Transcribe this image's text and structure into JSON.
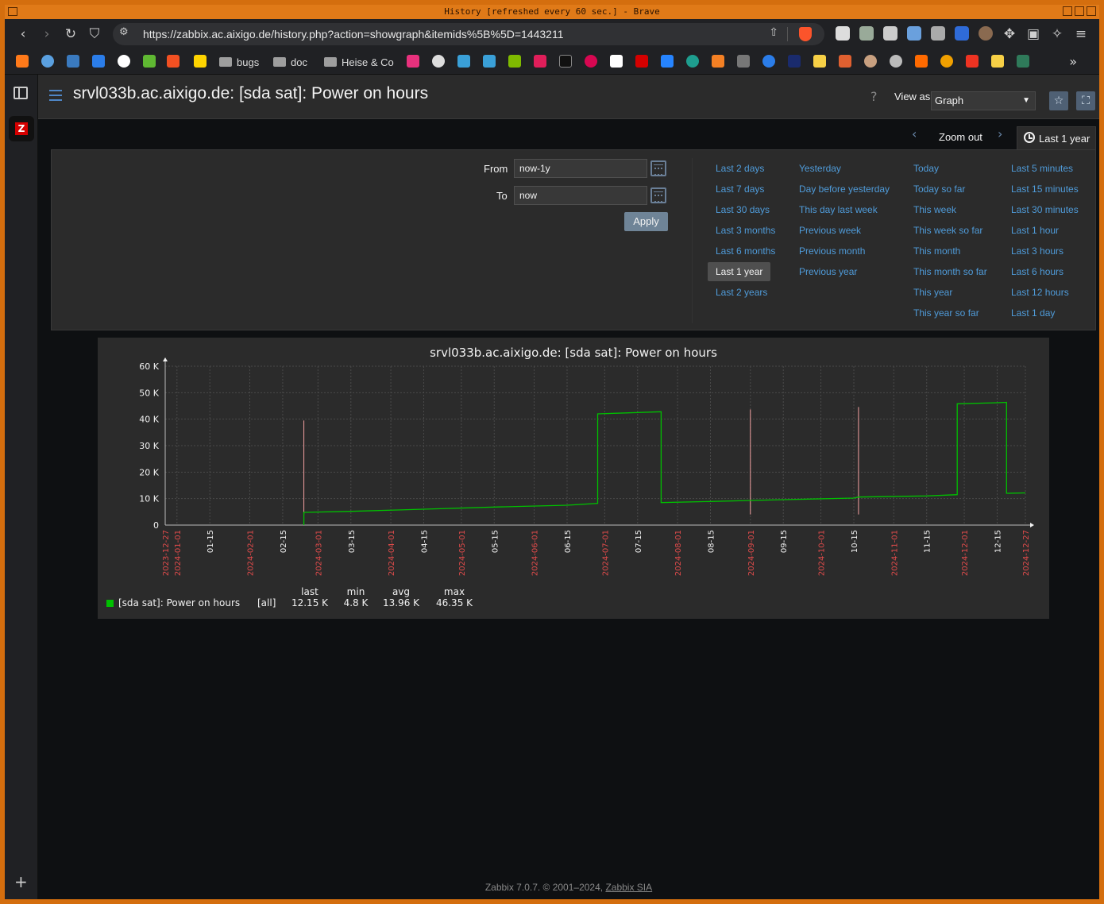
{
  "window": {
    "title": "History [refreshed every 60 sec.] - Brave"
  },
  "browser": {
    "url": "https://zabbix.ac.aixigo.de/history.php?action=showgraph&itemids%5B%5D=1443211",
    "bookmarks": [
      {
        "label": "bugs"
      },
      {
        "label": "doc"
      },
      {
        "label": "Heise & Co"
      }
    ],
    "more_symbol": "»"
  },
  "header": {
    "title": "srvl033b.ac.aixigo.de: [sda sat]: Power on hours",
    "help_symbol": "?",
    "view_as_label": "View as",
    "view_as_value": "Graph"
  },
  "timebar": {
    "zoom_out_label": "Zoom out",
    "active_tab_label": "Last 1 year"
  },
  "filter": {
    "from_label": "From",
    "from_value": "now-1y",
    "to_label": "To",
    "to_value": "now",
    "apply_label": "Apply",
    "quick_ranges": [
      [
        "Last 2 days",
        "Last 7 days",
        "Last 30 days",
        "Last 3 months",
        "Last 6 months",
        "Last 1 year",
        "Last 2 years"
      ],
      [
        "Yesterday",
        "Day before yesterday",
        "This day last week",
        "Previous week",
        "Previous month",
        "Previous year"
      ],
      [
        "Today",
        "Today so far",
        "This week",
        "This week so far",
        "This month",
        "This month so far",
        "This year",
        "This year so far"
      ],
      [
        "Last 5 minutes",
        "Last 15 minutes",
        "Last 30 minutes",
        "Last 1 hour",
        "Last 3 hours",
        "Last 6 hours",
        "Last 12 hours",
        "Last 1 day"
      ]
    ],
    "selected_range": "Last 1 year"
  },
  "chart_data": {
    "type": "line",
    "title": "srvl033b.ac.aixigo.de: [sda sat]: Power on hours",
    "y_ticks": [
      "0",
      "10 K",
      "20 K",
      "30 K",
      "40 K",
      "50 K",
      "60 K"
    ],
    "ylim": [
      0,
      60000
    ],
    "x_ticks": [
      {
        "label": "2023-12-27",
        "major": true
      },
      {
        "label": "2024-01-01",
        "major": true
      },
      {
        "label": "01-15",
        "major": false
      },
      {
        "label": "2024-02-01",
        "major": true
      },
      {
        "label": "02-15",
        "major": false
      },
      {
        "label": "2024-03-01",
        "major": true
      },
      {
        "label": "03-15",
        "major": false
      },
      {
        "label": "2024-04-01",
        "major": true
      },
      {
        "label": "04-15",
        "major": false
      },
      {
        "label": "2024-05-01",
        "major": true
      },
      {
        "label": "05-15",
        "major": false
      },
      {
        "label": "2024-06-01",
        "major": true
      },
      {
        "label": "06-15",
        "major": false
      },
      {
        "label": "2024-07-01",
        "major": true
      },
      {
        "label": "07-15",
        "major": false
      },
      {
        "label": "2024-08-01",
        "major": true
      },
      {
        "label": "08-15",
        "major": false
      },
      {
        "label": "2024-09-01",
        "major": true
      },
      {
        "label": "09-15",
        "major": false
      },
      {
        "label": "2024-10-01",
        "major": true
      },
      {
        "label": "10-15",
        "major": false
      },
      {
        "label": "2024-11-01",
        "major": true
      },
      {
        "label": "11-15",
        "major": false
      },
      {
        "label": "2024-12-01",
        "major": true
      },
      {
        "label": "12-15",
        "major": false
      },
      {
        "label": "2024-12-27",
        "major": true
      }
    ],
    "x_range": [
      "2023-12-27",
      "2024-12-27"
    ],
    "series": [
      {
        "name": "[sda sat]: Power on hours",
        "color": "#00c000",
        "x": [
          "2024-02-24",
          "2024-02-24",
          "2024-03-15",
          "2024-04-15",
          "2024-05-15",
          "2024-06-15",
          "2024-06-28",
          "2024-06-28",
          "2024-07-15",
          "2024-07-25",
          "2024-07-25",
          "2024-08-15",
          "2024-09-01",
          "2024-09-15",
          "2024-10-15",
          "2024-10-17",
          "2024-11-15",
          "2024-11-28",
          "2024-11-28",
          "2024-12-15",
          "2024-12-19",
          "2024-12-19",
          "2024-12-27"
        ],
        "y": [
          0,
          4800,
          5200,
          6000,
          6800,
          7500,
          8200,
          42000,
          42500,
          42800,
          8500,
          8900,
          9300,
          9600,
          10200,
          10600,
          11000,
          11500,
          45800,
          46200,
          46350,
          12000,
          12150
        ]
      }
    ],
    "spikes": [
      {
        "x": "2024-02-24",
        "y": 39500
      },
      {
        "x": "2024-09-01",
        "y": 43700
      },
      {
        "x": "2024-10-17",
        "y": 44600
      }
    ],
    "legend": {
      "series_label": "[sda sat]: Power on hours",
      "func": "[all]",
      "headers": [
        "last",
        "min",
        "avg",
        "max"
      ],
      "values": [
        "12.15 K",
        "4.8 K",
        "13.96 K",
        "46.35 K"
      ]
    }
  },
  "footer": {
    "text": "Zabbix 7.0.7. © 2001–2024, ",
    "link": "Zabbix SIA"
  },
  "colors": {
    "accent": "#4f9bd9",
    "major_tick": "#e04b4b",
    "series": "#00c000",
    "spike": "#f2a0a0"
  }
}
